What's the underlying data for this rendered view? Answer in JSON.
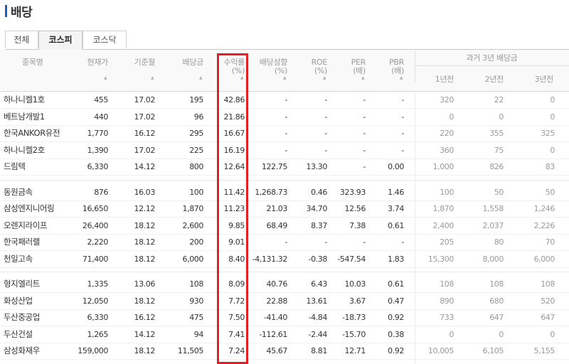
{
  "page": {
    "title": "배당"
  },
  "tabs": [
    {
      "label": "전체",
      "active": false
    },
    {
      "label": "코스피",
      "active": true
    },
    {
      "label": "코스닥",
      "active": false
    }
  ],
  "columns": {
    "name": "종목명",
    "price": "현재가",
    "base_month": "기준월",
    "dividend": "배당금",
    "yield": "수익률",
    "yield_unit": "(%)",
    "payout": "배당성향",
    "payout_unit": "(%)",
    "roe": "ROE",
    "roe_unit": "(%)",
    "per": "PER",
    "per_unit": "(배)",
    "pbr": "PBR",
    "pbr_unit": "(배)",
    "past_group": "과거 3년 배당금",
    "y1": "1년전",
    "y2": "2년전",
    "y3": "3년전"
  },
  "rows": [
    {
      "name": "하나니켈1호",
      "price": "455",
      "base_month": "17.02",
      "dividend": "195",
      "yield": "42.86",
      "payout": "-",
      "roe": "-",
      "per": "-",
      "pbr": "-",
      "y1": "320",
      "y2": "22",
      "y3": "0"
    },
    {
      "name": "베트남개발1",
      "price": "440",
      "base_month": "17.02",
      "dividend": "96",
      "yield": "21.86",
      "payout": "-",
      "roe": "-",
      "per": "-",
      "pbr": "-",
      "y1": "0",
      "y2": "0",
      "y3": "0"
    },
    {
      "name": "한국ANKOR유전",
      "price": "1,770",
      "base_month": "16.12",
      "dividend": "295",
      "yield": "16.67",
      "payout": "-",
      "roe": "-",
      "per": "-",
      "pbr": "-",
      "y1": "220",
      "y2": "355",
      "y3": "325"
    },
    {
      "name": "하나니켈2호",
      "price": "1,390",
      "base_month": "17.02",
      "dividend": "225",
      "yield": "16.19",
      "payout": "-",
      "roe": "-",
      "per": "-",
      "pbr": "-",
      "y1": "360",
      "y2": "75",
      "y3": "0"
    },
    {
      "name": "드림텍",
      "price": "6,330",
      "base_month": "14.12",
      "dividend": "800",
      "yield": "12.64",
      "payout": "122.75",
      "roe": "13.30",
      "per": "-",
      "pbr": "0.00",
      "y1": "1,000",
      "y2": "826",
      "y3": "83"
    },
    {
      "name": "동원금속",
      "price": "876",
      "base_month": "16.03",
      "dividend": "100",
      "yield": "11.42",
      "payout": "1,268.73",
      "roe": "0.46",
      "per": "323.93",
      "pbr": "1.46",
      "y1": "100",
      "y2": "50",
      "y3": "50"
    },
    {
      "name": "삼성엔지니어링",
      "price": "16,650",
      "base_month": "12.12",
      "dividend": "1,870",
      "yield": "11.23",
      "payout": "21.03",
      "roe": "34.70",
      "per": "12.56",
      "pbr": "3.74",
      "y1": "1,870",
      "y2": "1,558",
      "y3": "1,246"
    },
    {
      "name": "오렌지라이프",
      "price": "26,400",
      "base_month": "18.12",
      "dividend": "2,600",
      "yield": "9.85",
      "payout": "68.49",
      "roe": "8.37",
      "per": "7.38",
      "pbr": "0.61",
      "y1": "2,400",
      "y2": "2,037",
      "y3": "2,226"
    },
    {
      "name": "한국패러랠",
      "price": "2,220",
      "base_month": "18.12",
      "dividend": "200",
      "yield": "9.01",
      "payout": "-",
      "roe": "-",
      "per": "-",
      "pbr": "-",
      "y1": "205",
      "y2": "80",
      "y3": "70"
    },
    {
      "name": "천일고속",
      "price": "71,400",
      "base_month": "18.12",
      "dividend": "6,000",
      "yield": "8.40",
      "payout": "-4,131.32",
      "roe": "-0.38",
      "per": "-547.54",
      "pbr": "1.83",
      "y1": "15,300",
      "y2": "8,000",
      "y3": "6,000"
    },
    {
      "name": "형지엘리트",
      "price": "1,335",
      "base_month": "13.06",
      "dividend": "108",
      "yield": "8.09",
      "payout": "40.76",
      "roe": "6.43",
      "per": "10.03",
      "pbr": "0.61",
      "y1": "108",
      "y2": "108",
      "y3": "108"
    },
    {
      "name": "화성산업",
      "price": "12,050",
      "base_month": "18.12",
      "dividend": "930",
      "yield": "7.72",
      "payout": "22.88",
      "roe": "13.61",
      "per": "3.67",
      "pbr": "0.47",
      "y1": "890",
      "y2": "680",
      "y3": "520"
    },
    {
      "name": "두산중공업",
      "price": "6,330",
      "base_month": "16.12",
      "dividend": "475",
      "yield": "7.50",
      "payout": "-41.40",
      "roe": "-4.84",
      "per": "-18.73",
      "pbr": "0.92",
      "y1": "733",
      "y2": "647",
      "y3": "647"
    },
    {
      "name": "두산건설",
      "price": "1,265",
      "base_month": "14.12",
      "dividend": "94",
      "yield": "7.41",
      "payout": "-112.61",
      "roe": "-2.44",
      "per": "-15.70",
      "pbr": "0.38",
      "y1": "0",
      "y2": "0",
      "y3": "0"
    },
    {
      "name": "삼성화재우",
      "price": "159,000",
      "base_month": "18.12",
      "dividend": "11,505",
      "yield": "7.24",
      "payout": "45.67",
      "roe": "8.81",
      "per": "12.71",
      "pbr": "0.92",
      "y1": "10,005",
      "y2": "6,105",
      "y3": "5,155"
    }
  ],
  "icons": {
    "sort": "sort-up-icon"
  },
  "colors": {
    "highlight": "#e31e24",
    "title_mark": "#1f5fbf"
  }
}
